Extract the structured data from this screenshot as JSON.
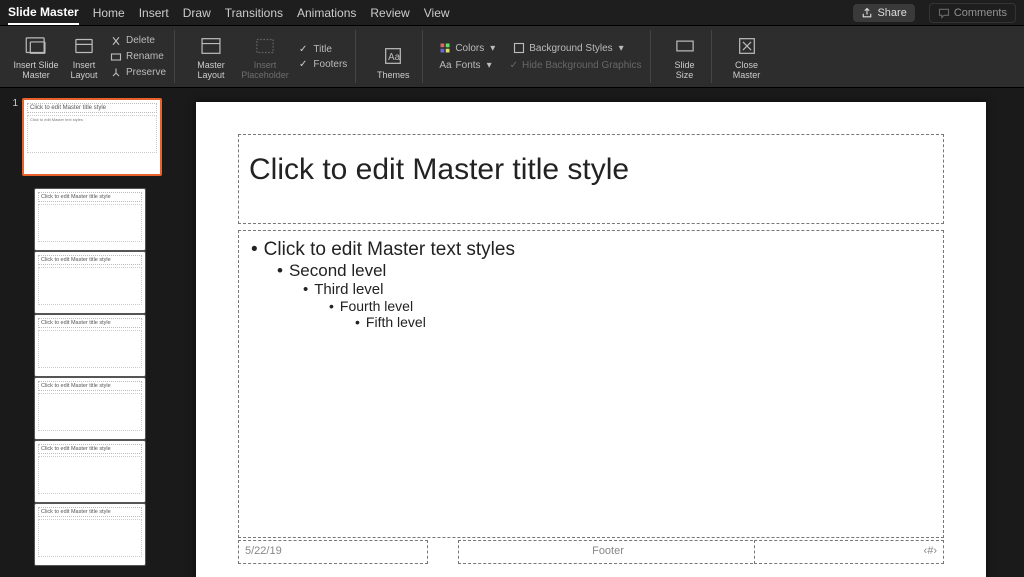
{
  "tabs": {
    "items": [
      "Slide Master",
      "Home",
      "Insert",
      "Draw",
      "Transitions",
      "Animations",
      "Review",
      "View"
    ],
    "active": 0
  },
  "topButtons": {
    "share": "Share",
    "comments": "Comments"
  },
  "ribbon": {
    "insertSlideMaster": "Insert Slide\nMaster",
    "insertLayout": "Insert\nLayout",
    "delete": "Delete",
    "rename": "Rename",
    "preserve": "Preserve",
    "masterLayout": "Master\nLayout",
    "insertPlaceholder": "Insert\nPlaceholder",
    "titleChk": "Title",
    "footersChk": "Footers",
    "themes": "Themes",
    "colors": "Colors",
    "fonts": "Fonts",
    "backgroundStyles": "Background Styles",
    "hideBg": "Hide Background Graphics",
    "slideSize": "Slide\nSize",
    "closeMaster": "Close\nMaster"
  },
  "thumbnails": {
    "masterNumber": "1",
    "items": [
      {
        "kind": "master",
        "title": "Click to edit Master title style",
        "body": "Click to edit Master text styles"
      },
      {
        "kind": "layout",
        "title": "Click to edit Master title style",
        "body": ""
      },
      {
        "kind": "layout",
        "title": "Click to edit Master title style",
        "body": ""
      },
      {
        "kind": "layout",
        "title": "Click to edit Master title style",
        "body": ""
      },
      {
        "kind": "layout",
        "title": "Click to edit Master title style",
        "body": ""
      },
      {
        "kind": "layout",
        "title": "Click to edit Master title style",
        "body": ""
      },
      {
        "kind": "layout",
        "title": "Click to edit Master title style",
        "body": ""
      }
    ]
  },
  "slide": {
    "title": "Click to edit Master title style",
    "bullets": {
      "l1": "Click to edit Master text styles",
      "l2": "Second level",
      "l3": "Third level",
      "l4": "Fourth level",
      "l5": "Fifth level"
    },
    "date": "5/22/19",
    "footer": "Footer",
    "slideNum": "‹#›"
  }
}
